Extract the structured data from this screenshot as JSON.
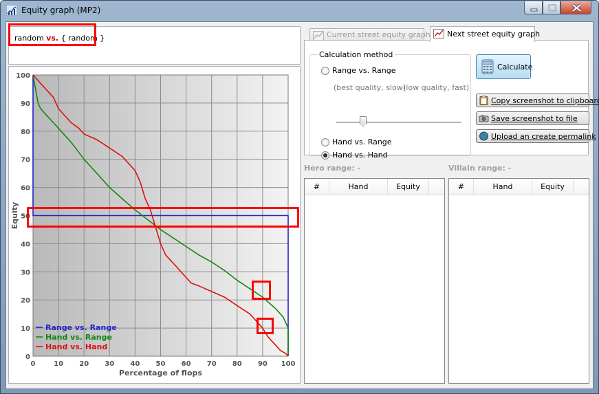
{
  "window": {
    "title": "Equity graph (MP2)"
  },
  "range_box": {
    "left": "random",
    "vs": "vs.",
    "right": "{ random }"
  },
  "tabs": [
    {
      "label": "Current street equity graph",
      "active": false
    },
    {
      "label": "Next street equity graph",
      "active": true
    }
  ],
  "calc": {
    "title": "Calculation method",
    "options": [
      "Range vs. Range",
      "Hand vs. Range",
      "Hand vs. Hand"
    ],
    "selected": "Hand vs. Hand",
    "slider_left_hint": "(best quality, slow)",
    "slider_right_hint": "(low quality, fast)",
    "slider_position": 0.2
  },
  "buttons": {
    "calculate": "Calculate",
    "copy": "Copy screenshot to clipboard",
    "save": "Save screenshot to file",
    "upload": "Upload an create permalink"
  },
  "hero": {
    "title": "Hero range: -",
    "columns": [
      "#",
      "Hand",
      "Equity"
    ]
  },
  "villain": {
    "title": "Villain range: -",
    "columns": [
      "#",
      "Hand",
      "Equity"
    ]
  },
  "colors": {
    "range_vs_range": "#2222cc",
    "hand_vs_range": "#118811",
    "hand_vs_hand": "#dd1111",
    "highlight": "#ff0000"
  },
  "chart_data": {
    "type": "line",
    "xlabel": "Percentage of flops",
    "ylabel": "Equity",
    "xlim": [
      0,
      100
    ],
    "ylim": [
      0,
      100
    ],
    "x_ticks": [
      0,
      10,
      20,
      30,
      40,
      50,
      60,
      70,
      80,
      90,
      100
    ],
    "y_ticks": [
      0,
      10,
      20,
      30,
      40,
      50,
      60,
      70,
      80,
      90,
      100
    ],
    "grid": true,
    "legend": "bottom-left",
    "series": [
      {
        "name": "Range vs. Range",
        "color": "#2222cc",
        "x": [
          0,
          0,
          100,
          100
        ],
        "y": [
          100,
          50,
          50,
          0
        ]
      },
      {
        "name": "Hand vs. Range",
        "color": "#118811",
        "x": [
          0,
          1,
          2,
          3,
          5,
          8,
          10,
          15,
          20,
          25,
          30,
          35,
          40,
          45,
          50,
          55,
          60,
          65,
          70,
          75,
          80,
          85,
          90,
          95,
          98,
          99,
          100,
          100
        ],
        "y": [
          100,
          95,
          90,
          88,
          86,
          83,
          81,
          76,
          70,
          65,
          60,
          56,
          52,
          48.5,
          45,
          42,
          39,
          36,
          33.5,
          30.5,
          27,
          24,
          21,
          17,
          14,
          12,
          10,
          0
        ]
      },
      {
        "name": "Hand vs. Hand",
        "color": "#dd1111",
        "x": [
          0,
          2,
          5,
          8,
          10,
          13,
          15,
          18,
          20,
          25,
          30,
          35,
          38,
          40,
          42,
          44,
          46,
          48,
          50,
          52,
          55,
          58,
          60,
          62,
          65,
          70,
          75,
          80,
          85,
          88,
          90,
          92,
          95,
          97,
          99,
          100
        ],
        "y": [
          100,
          98,
          95,
          92,
          88,
          85,
          83,
          81,
          79,
          77,
          74,
          71,
          68,
          66,
          62,
          56,
          52,
          46,
          40,
          36,
          33,
          30,
          28,
          26,
          25,
          23,
          21,
          18,
          15,
          12,
          10,
          7,
          4,
          2,
          1,
          0
        ]
      }
    ]
  },
  "annotations": [
    {
      "target": "range-text",
      "color": "#ff0000"
    },
    {
      "target": "equity-50-line",
      "color": "#ff0000"
    },
    {
      "target": "green-curve-near-90",
      "color": "#ff0000"
    },
    {
      "target": "red-curve-near-90",
      "color": "#ff0000"
    }
  ]
}
